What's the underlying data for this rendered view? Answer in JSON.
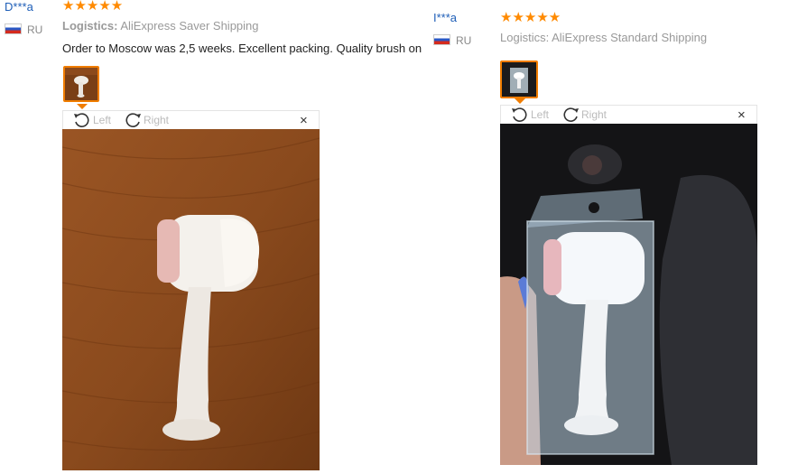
{
  "reviews": [
    {
      "user": "D***a",
      "country": "RU",
      "stars": "★★★★★",
      "logistics_label": "Logistics:",
      "logistics_value": "AliExpress Saver Shipping",
      "text": "Order to Moscow was 2,5 weeks. Excellent packing. Quality brush on",
      "rotate_left": "Left",
      "rotate_right": "Right",
      "close": "×"
    },
    {
      "user": "I***a",
      "country": "RU",
      "stars": "★★★★★",
      "logistics_label": "Logistics:",
      "logistics_value": "AliExpress Standard Shipping",
      "rotate_left": "Left",
      "rotate_right": "Right",
      "close": "×"
    }
  ],
  "colors": {
    "star": "#ff8a00",
    "accent_border": "#f07d00",
    "username": "#1f5fb8"
  }
}
